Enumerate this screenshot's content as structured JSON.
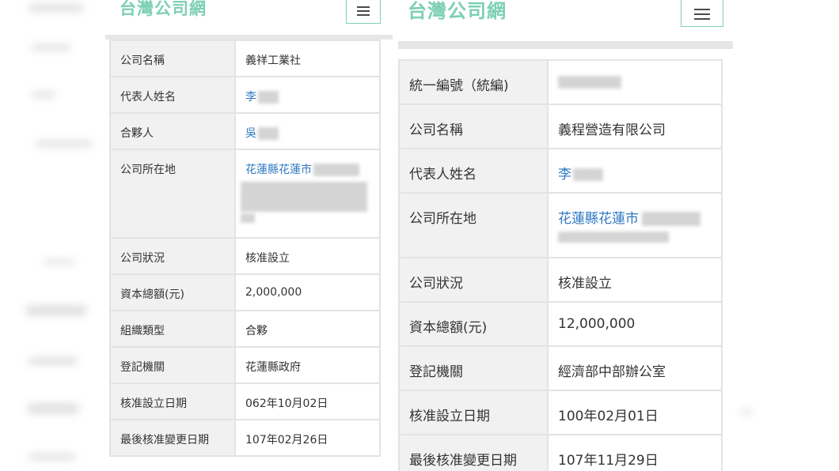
{
  "left": {
    "site_title": "台灣公司網",
    "rows": [
      {
        "label": "公司名稱",
        "value": "義祥工業社"
      },
      {
        "label": "代表人姓名",
        "value": "李"
      },
      {
        "label": "合夥人",
        "value": "吳"
      },
      {
        "label": "公司所在地",
        "value": "花蓮縣花蓮市"
      },
      {
        "label": "公司狀況",
        "value": "核准設立"
      },
      {
        "label": "資本總額(元)",
        "value": "2,000,000"
      },
      {
        "label": "組織類型",
        "value": "合夥"
      },
      {
        "label": "登記機關",
        "value": "花蓮縣政府"
      },
      {
        "label": "核准設立日期",
        "value": "062年10月02日"
      },
      {
        "label": "最後核准變更日期",
        "value": "107年02月26日"
      }
    ]
  },
  "right": {
    "site_title": "台灣公司網",
    "rows": [
      {
        "label": "統一編號（統編)",
        "value": ""
      },
      {
        "label": "公司名稱",
        "value": "義程營造有限公司"
      },
      {
        "label": "代表人姓名",
        "value": "李"
      },
      {
        "label": "公司所在地",
        "value": "花蓮縣花蓮市"
      },
      {
        "label": "公司狀況",
        "value": "核准設立"
      },
      {
        "label": "資本總額(元)",
        "value": "12,000,000"
      },
      {
        "label": "登記機關",
        "value": "經濟部中部辦公室"
      },
      {
        "label": "核准設立日期",
        "value": "100年02月01日"
      },
      {
        "label": "最後核准變更日期",
        "value": "107年11月29日"
      }
    ]
  },
  "colors": {
    "brand": "#7ccfb4",
    "link": "#2f78c4",
    "label_bg": "#f1f1f1",
    "border": "#e3e3e3"
  },
  "icons": {
    "menu": "hamburger-menu-icon"
  }
}
